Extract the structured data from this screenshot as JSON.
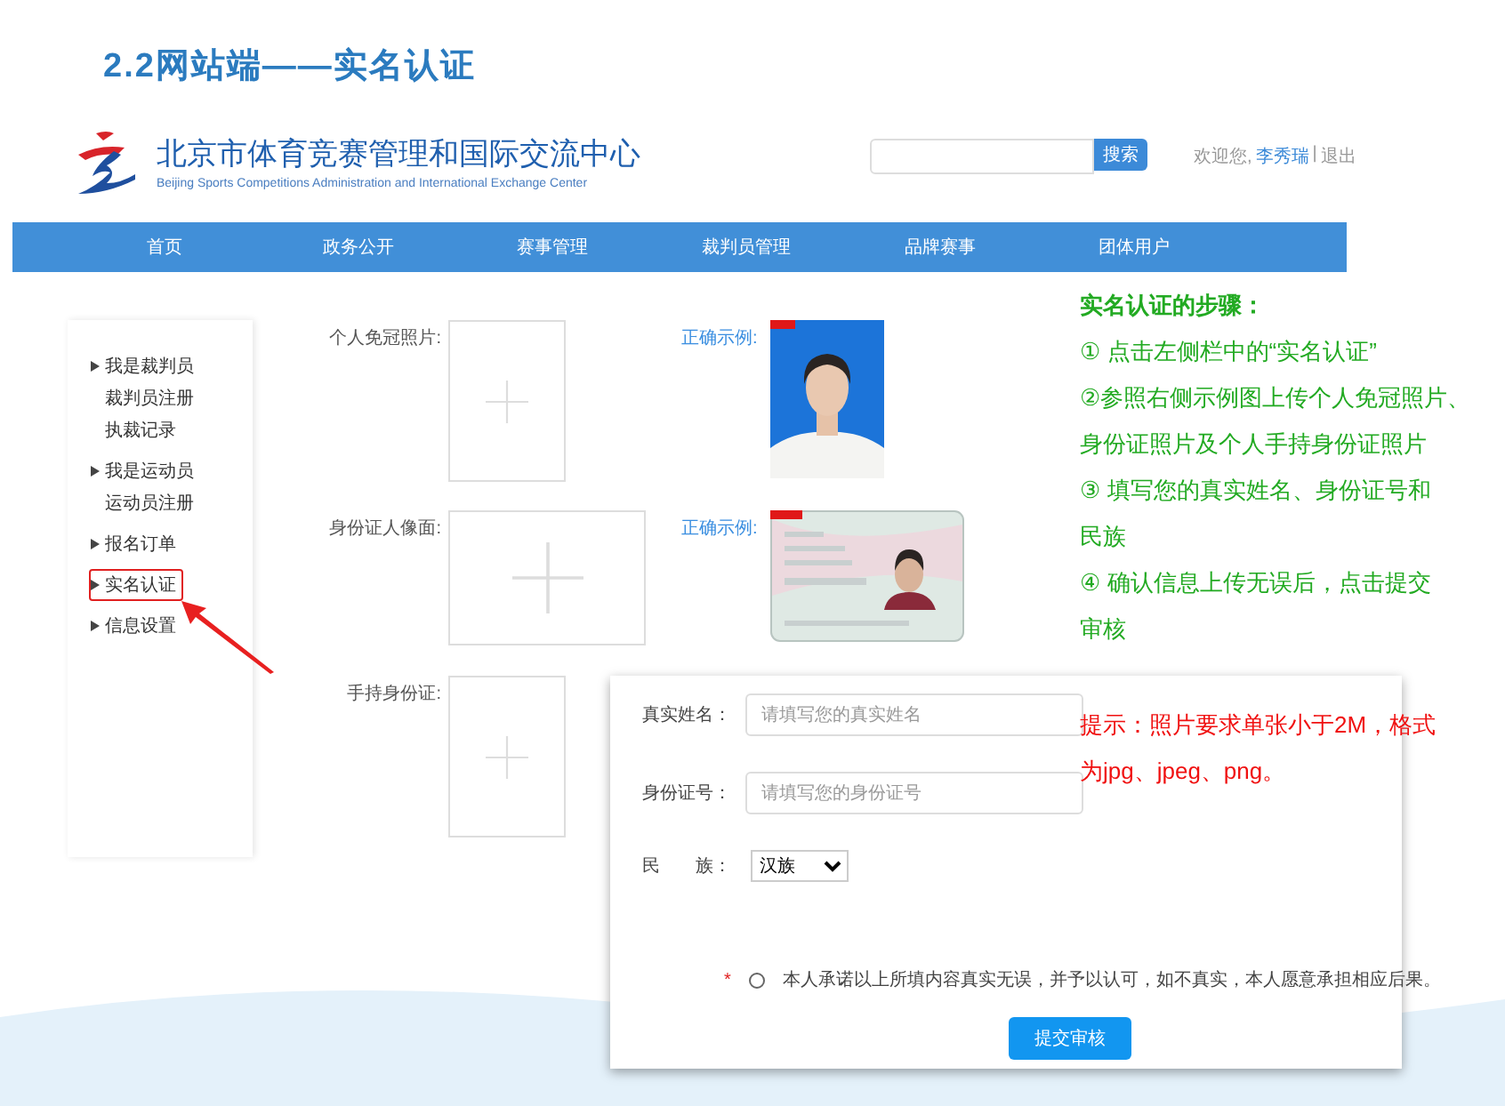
{
  "slide_title": "2.2网站端——实名认证",
  "site": {
    "name": "北京市体育竞赛管理和国际交流中心",
    "name_en": "Beijing Sports Competitions Administration and International Exchange Center",
    "search_button": "搜索",
    "welcome": "欢迎您,",
    "user": "李秀瑞",
    "separator": "|",
    "logout": "退出"
  },
  "nav": [
    {
      "label": "首页"
    },
    {
      "label": "政务公开"
    },
    {
      "label": "赛事管理"
    },
    {
      "label": "裁判员管理"
    },
    {
      "label": "品牌赛事"
    },
    {
      "label": "团体用户"
    }
  ],
  "sidebar": [
    {
      "label": "我是裁判员",
      "highlighted": false,
      "children": [
        {
          "label": "裁判员注册",
          "highlighted": false
        },
        {
          "label": "执裁记录",
          "highlighted": false
        }
      ]
    },
    {
      "label": "我是运动员",
      "highlighted": false,
      "children": [
        {
          "label": "运动员注册",
          "highlighted": false
        }
      ]
    },
    {
      "label": "报名订单",
      "highlighted": false
    },
    {
      "label": "实名认证",
      "highlighted": true
    },
    {
      "label": "信息设置",
      "highlighted": false
    }
  ],
  "uploads": [
    {
      "label": "个人免冠照片:",
      "kind": "portrait",
      "example_label": "正确示例:"
    },
    {
      "label": "身份证人像面:",
      "kind": "id_card",
      "example_label": "正确示例:"
    },
    {
      "label": "手持身份证:",
      "kind": "handheld"
    }
  ],
  "steps": {
    "title": "实名认证的步骤：",
    "items": [
      [
        "① 点击左侧栏中的“实名认证”"
      ],
      [
        "②参照右侧示例图上传个人免冠照片、",
        "身份证照片及个人手持身份证照片"
      ],
      [
        "③ 填写您的真实姓名、身份证号和",
        "民族"
      ],
      [
        "④ 确认信息上传无误后，点击提交",
        "审核"
      ]
    ]
  },
  "hint": [
    "提示：照片要求单张小于2M，格式",
    "为jpg、jpeg、png。"
  ],
  "form": {
    "fields": [
      {
        "label": "真实姓名：",
        "placeholder": "请填写您的真实姓名"
      },
      {
        "label": "身份证号：",
        "placeholder": "请填写您的身份证号"
      }
    ],
    "select": {
      "label": "民　　族：",
      "value": "汉族"
    },
    "pledge": {
      "required_mark": "*",
      "checked": false,
      "text": "本人承诺以上所填内容真实无误，并予以认可，如不真实，本人愿意承担相应后果。"
    },
    "submit": "提交审核"
  }
}
